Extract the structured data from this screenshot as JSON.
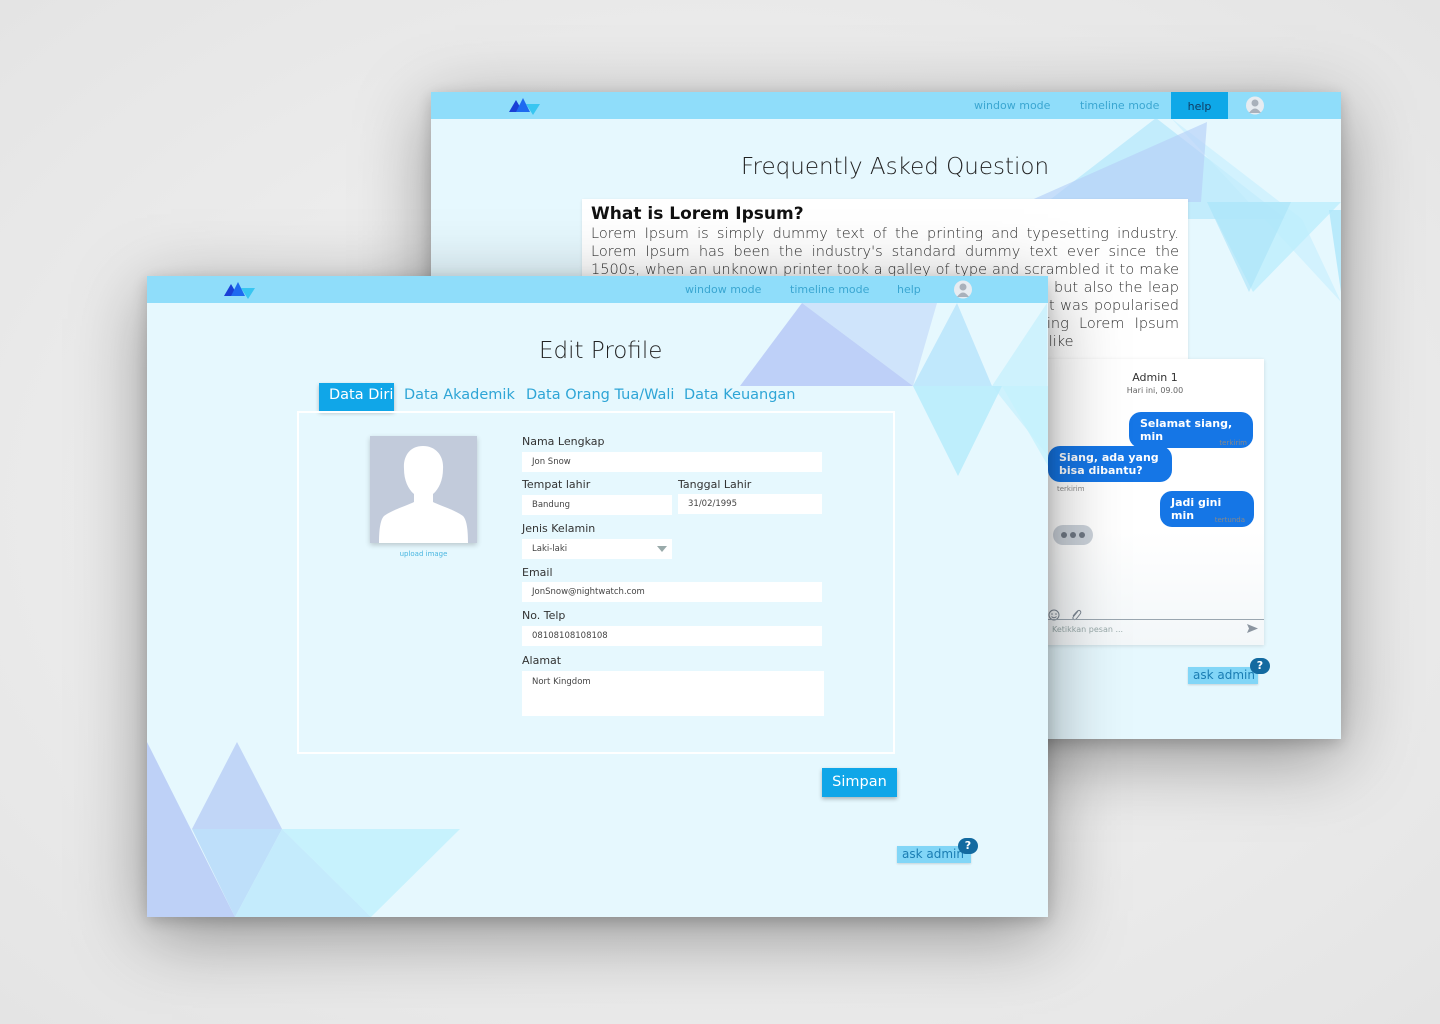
{
  "back_screen": {
    "nav": {
      "window_mode": "window mode",
      "timeline_mode": "timeline mode",
      "help": "help"
    },
    "title": "Frequently Asked Question",
    "faq": {
      "question": "What is Lorem Ipsum?",
      "answer": "Lorem Ipsum is simply dummy text of the printing and typesetting industry. Lorem Ipsum has been the industry's standard dummy text ever since the 1500s, when an unknown printer took a galley of type and scrambled it to make a type specimen book. It has survived not only five centuries, but also the leap into electronic typesetting, remaining essentially unchanged. It was popularised in the 1960s with the release of Letraset sheets containing Lorem Ipsum passages, and more recently with desktop publishing software like"
    },
    "chat": {
      "admin_name": "Admin 1",
      "time": "Hari ini, 09.00",
      "messages": [
        {
          "text": "Selamat siang, min",
          "status": "terkirim"
        },
        {
          "text": "Siang, ada yang bisa dibantu?",
          "status": "terkirim"
        },
        {
          "text": "Jadi gini min",
          "status": "tertunda"
        }
      ],
      "input_placeholder": "Ketikkan pesan ..."
    },
    "ask_admin": "ask admin",
    "help_icon": "?"
  },
  "front_screen": {
    "nav": {
      "window_mode": "window mode",
      "timeline_mode": "timeline mode",
      "help": "help"
    },
    "title": "Edit Profile",
    "tabs": [
      "Data Diri",
      "Data Akademik",
      "Data Orang Tua/Wali",
      "Data Keuangan"
    ],
    "upload_label": "upload image",
    "fields": {
      "nama_label": "Nama Lengkap",
      "nama_value": "Jon Snow",
      "tempat_label": "Tempat lahir",
      "tempat_value": "Bandung",
      "tanggal_label": "Tanggal Lahir",
      "tanggal_value": "31/02/1995",
      "kelamin_label": "Jenis Kelamin",
      "kelamin_value": "Laki-laki",
      "email_label": "Email",
      "email_value": "JonSnow@nightwatch.com",
      "telp_label": "No. Telp",
      "telp_value": "08108108108108",
      "alamat_label": "Alamat",
      "alamat_value": "Nort Kingdom"
    },
    "save_button": "Simpan",
    "ask_admin": "ask admin",
    "help_icon": "?"
  },
  "icons": {
    "logo": "mountain-logo-icon",
    "avatar": "user-avatar-icon",
    "emoji": "emoji-icon",
    "attach": "paperclip-icon",
    "send": "send-icon"
  },
  "colors": {
    "topbar": "#8fddfa",
    "accent": "#10a6e8",
    "screen_bg": "#e6f8fe",
    "chat_bubble": "#1576e6"
  }
}
